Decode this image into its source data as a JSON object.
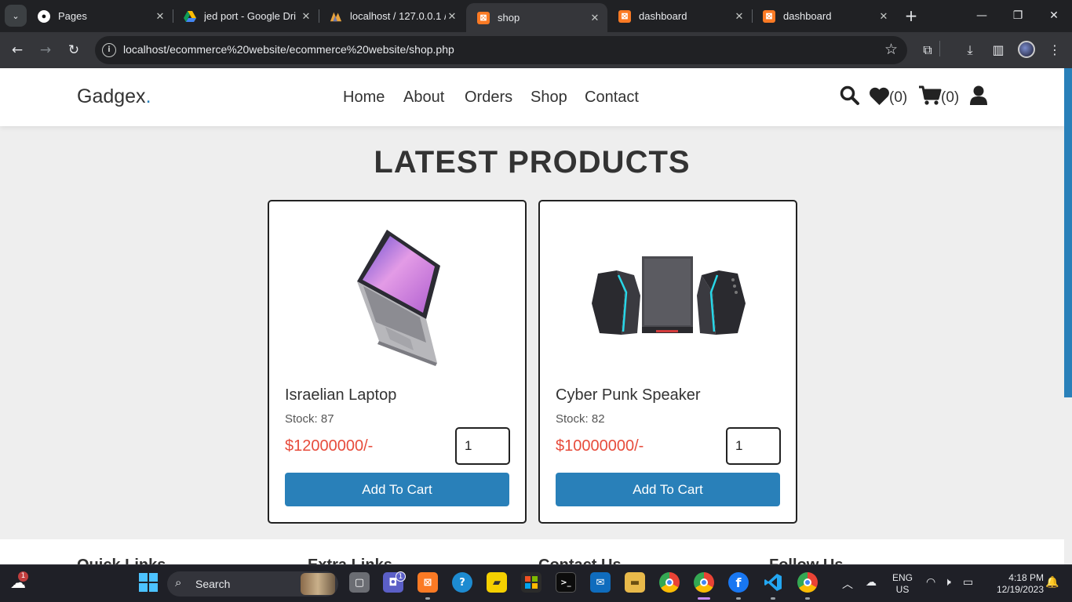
{
  "browser": {
    "tabs": [
      {
        "title": "Pages",
        "icon": "github-icon"
      },
      {
        "title": "jed port - Google Dri",
        "icon": "google-drive-icon"
      },
      {
        "title": "localhost / 127.0.0.1 /",
        "icon": "phpmyadmin-icon"
      },
      {
        "title": "shop",
        "icon": "xampp-icon",
        "active": true
      },
      {
        "title": "dashboard",
        "icon": "xampp-icon"
      },
      {
        "title": "dashboard",
        "icon": "xampp-icon"
      }
    ],
    "url": "localhost/ecommerce%20website/ecommerce%20website/shop.php"
  },
  "site": {
    "logo": "Gadgex",
    "logo_dot": ".",
    "nav": [
      "Home",
      "About",
      "Orders",
      "Shop",
      "Contact"
    ],
    "wishlist_count": "(0)",
    "cart_count": "(0)",
    "accent_color": "#2980b9",
    "price_color": "#e74c3c"
  },
  "main": {
    "heading": "LATEST PRODUCTS",
    "products": [
      {
        "name": "Israelian Laptop",
        "stock": "Stock: 87",
        "price": "$12000000/-",
        "qty": "1",
        "button": "Add To Cart",
        "image": "laptop-image"
      },
      {
        "name": "Cyber Punk Speaker",
        "stock": "Stock: 82",
        "price": "$10000000/-",
        "qty": "1",
        "button": "Add To Cart",
        "image": "speaker-image"
      }
    ]
  },
  "footer": {
    "columns": [
      "Quick Links",
      "Extra Links",
      "Contact Us",
      "Follow Us"
    ]
  },
  "taskbar": {
    "search_label": "Search",
    "weather_badge": "1",
    "teams_badge": "1",
    "lang": "ENG",
    "region": "US",
    "time": "4:18 PM",
    "date": "12/19/2023"
  }
}
